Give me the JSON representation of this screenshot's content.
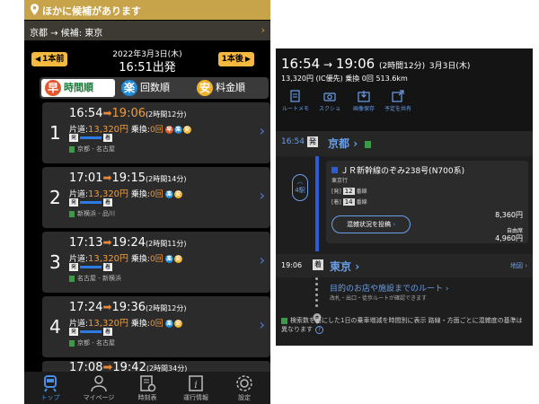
{
  "left": {
    "banner": "ほかに候補があります",
    "route": "京都 → 候補: 東京",
    "nav": {
      "prev": "1本前",
      "next": "1本後",
      "date": "2022年3月3日(木)",
      "dep": "16:51出発"
    },
    "tabs": [
      {
        "icon": "早",
        "label": "時間順",
        "color": "#e2582c"
      },
      {
        "icon": "楽",
        "label": "回数順",
        "color": "#1f8ad6"
      },
      {
        "icon": "安",
        "label": "料金順",
        "color": "#f0b22c"
      }
    ],
    "rows": [
      {
        "num": "1",
        "dep": "16:54",
        "arr": "19:06",
        "dur": "(2時間12分)",
        "fare_label": "片道:",
        "fare": "13,320円",
        "transfer_label": "乗換:",
        "transfer": "0回",
        "stations": "京都 - 名古屋",
        "highlight": true,
        "badges": [
          "早",
          "楽",
          "安"
        ]
      },
      {
        "num": "2",
        "dep": "17:01",
        "arr": "19:15",
        "dur": "(2時間14分)",
        "fare_label": "片道:",
        "fare": "13,320円",
        "transfer_label": "乗換:",
        "transfer": "0回",
        "stations": "新横浜 - 品川",
        "highlight": false,
        "badges": [
          "楽",
          "安"
        ]
      },
      {
        "num": "3",
        "dep": "17:13",
        "arr": "19:24",
        "dur": "(2時間11分)",
        "fare_label": "片道:",
        "fare": "13,320円",
        "transfer_label": "乗換:",
        "transfer": "0回",
        "stations": "名古屋 - 新横浜",
        "highlight": false,
        "badges": [
          "楽",
          "安"
        ]
      },
      {
        "num": "4",
        "dep": "17:24",
        "arr": "19:36",
        "dur": "(2時間12分)",
        "fare_label": "片道:",
        "fare": "13,320円",
        "transfer_label": "乗換:",
        "transfer": "0回",
        "stations": "京都 - 名古屋",
        "highlight": false,
        "badges": [
          "楽",
          "安"
        ]
      }
    ],
    "peek": {
      "dep": "17:08",
      "arr": "19:42",
      "dur": "(2時間34分)"
    },
    "seg_labels": {
      "dep": "発",
      "arr": "着"
    },
    "tabbar": [
      {
        "label": "トップ",
        "icon": "train-icon"
      },
      {
        "label": "マイページ",
        "icon": "person-icon"
      },
      {
        "label": "時刻表",
        "icon": "timetable-icon"
      },
      {
        "label": "運行情報",
        "icon": "info-icon"
      },
      {
        "label": "設定",
        "icon": "gear-icon"
      }
    ]
  },
  "right": {
    "title_dep": "16:54",
    "title_arr": "19:06",
    "title_dur": "(2時間12分)",
    "title_date": "3月3日(木)",
    "subtitle": "13,320円 (IC優先) 乗換 0回 513.6km",
    "actions": [
      {
        "label": "ルートメモ",
        "icon": "memo-icon"
      },
      {
        "label": "スクショ",
        "icon": "camera-icon"
      },
      {
        "label": "画像保存",
        "icon": "save-image-icon"
      },
      {
        "label": "予定を共有",
        "icon": "calendar-share-icon"
      }
    ],
    "dep_time": "16:54",
    "dep_badge": "発",
    "dep_station": "京都",
    "stops": "4駅",
    "train_name": "ＪＲ新幹線のぞみ238号(N700系)",
    "train_dir": "東京行",
    "dep_platform_tag": "[発]",
    "dep_platform": "12",
    "arr_platform_tag": "[着]",
    "arr_platform": "14",
    "platform_suffix": "番線",
    "crowd_button": "混雑状況を投稿",
    "fare_base": "8,360円",
    "fare_label": "自由席",
    "fare_seat": "4,960円",
    "arr_time": "19:06",
    "arr_badge": "着",
    "arr_station": "東京",
    "map_link": "地図",
    "dest_title": "目的のお店や施設までのルート",
    "dest_sub": "改札・出口・徒歩ルートが確認できます",
    "note": "検索数を基にした1日の乗車増減を時間別に表示 路線・方面ごとに混雑度の基準は異なります"
  },
  "colors": {
    "gold": "#c7a34a",
    "orange": "#f29a3a",
    "blue_link": "#6a9fe8",
    "line_blue": "#2c5bd7"
  }
}
